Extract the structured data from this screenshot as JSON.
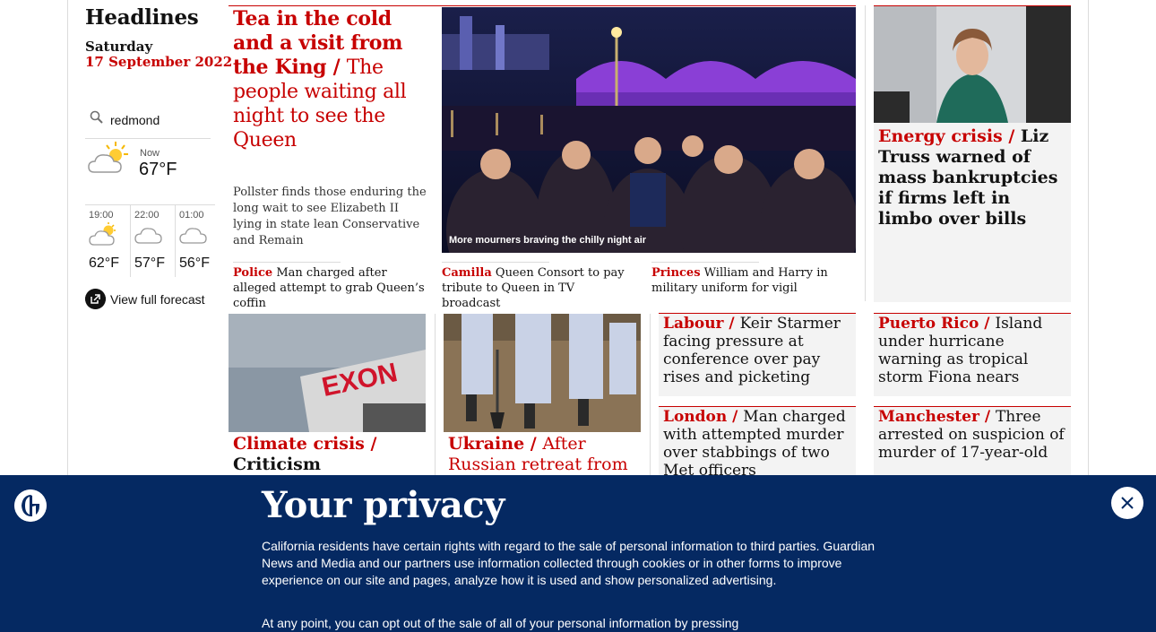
{
  "sidebar": {
    "section_title": "Headlines",
    "day": "Saturday",
    "date": "17 September 2022",
    "weather": {
      "location": "redmond",
      "now_label": "Now",
      "now_temp": "67°F",
      "now_icon": "partly-cloudy-sun-icon",
      "forecast": [
        {
          "time": "19:00",
          "temp": "62°F",
          "icon": "partly-cloudy-sun-icon"
        },
        {
          "time": "22:00",
          "temp": "57°F",
          "icon": "cloud-icon"
        },
        {
          "time": "01:00",
          "temp": "56°F",
          "icon": "cloud-icon"
        }
      ],
      "full_forecast_label": "View full forecast"
    }
  },
  "main_story": {
    "kicker": "Tea in the cold and a visit from the King",
    "headline": "The people waiting all night to see the Queen",
    "standfirst": "Pollster finds those enduring the long wait to see Elizabeth II lying in state lean Conservative and Remain",
    "image_caption": "More mourners braving the chilly night air",
    "sublinks": [
      {
        "kicker": "Police",
        "text": "Man charged after alleged attempt to grab Queen’s coffin"
      },
      {
        "kicker": "Camilla",
        "text": "Queen Consort to pay tribute to Queen in TV broadcast"
      },
      {
        "kicker": "Princes",
        "text": "William and Harry in military uniform for vigil"
      }
    ]
  },
  "energy_story": {
    "kicker": "Energy crisis /",
    "headline": "Liz Truss warned of mass bankruptcies if firms left in limbo over bills"
  },
  "climate_story": {
    "kicker": "Climate crisis /",
    "headline": "Criticism intensifies"
  },
  "ukraine_story": {
    "kicker": "Ukraine /",
    "headline": "After Russian retreat from"
  },
  "small_stories": [
    {
      "kicker": "Labour /",
      "headline": "Keir Starmer facing pressure at conference over pay rises and picketing"
    },
    {
      "kicker": "Puerto Rico /",
      "headline": "Island under hurricane warning as tropical storm Fiona nears"
    },
    {
      "kicker": "London /",
      "headline": "Man charged with attempted murder over stabbings of two Met officers"
    },
    {
      "kicker": "Manchester /",
      "headline": "Three arrested on suspicion of murder of 17-year-old"
    }
  ],
  "privacy": {
    "title": "Your privacy",
    "paragraph1": "California residents have certain rights with regard to the sale of personal information to third parties. Guardian News and Media and our partners use information collected through cookies or in other forms to improve experience on our site and pages, analyze how it is used and show personalized advertising.",
    "paragraph2": "At any point, you can opt out of the sale of all of your personal information by pressing"
  }
}
